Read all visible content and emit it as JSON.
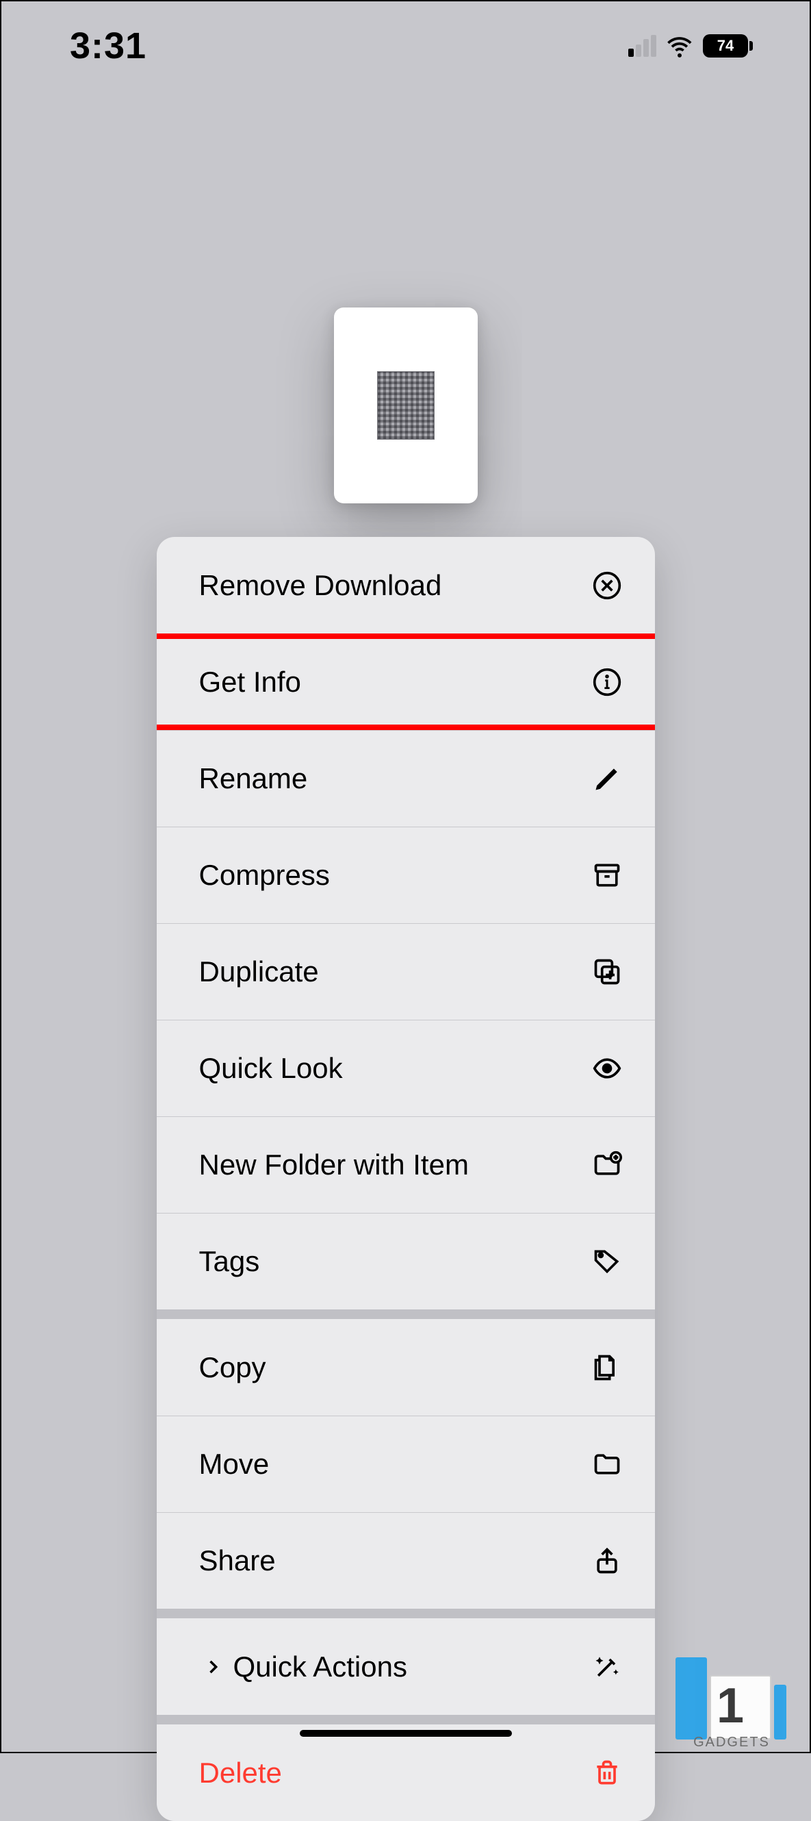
{
  "status_bar": {
    "time": "3:31",
    "battery_level": "74"
  },
  "menu": {
    "group1": {
      "remove_download": "Remove Download",
      "get_info": "Get Info",
      "rename": "Rename",
      "compress": "Compress",
      "duplicate": "Duplicate",
      "quick_look": "Quick Look",
      "new_folder": "New Folder with Item",
      "tags": "Tags"
    },
    "group2": {
      "copy": "Copy",
      "move": "Move",
      "share": "Share"
    },
    "group3": {
      "quick_actions": "Quick Actions"
    },
    "group4": {
      "delete": "Delete"
    }
  },
  "watermark": "GADGETS"
}
